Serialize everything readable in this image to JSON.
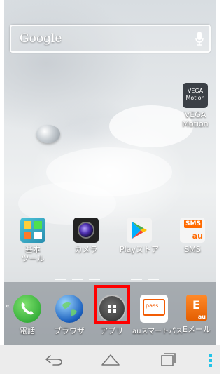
{
  "search": {
    "label": "Google"
  },
  "home_apps": [
    {
      "label": "VEGA\nMotion",
      "icon": "vega-motion-icon",
      "icon_text": "VEGA\nMotion"
    },
    {
      "label": "基本\nツール",
      "icon": "tools-folder-icon"
    },
    {
      "label": "カメラ",
      "icon": "camera-icon"
    },
    {
      "label": "Playストア",
      "icon": "play-store-icon"
    },
    {
      "label": "SMS",
      "icon": "sms-icon",
      "icon_text": "SMS"
    }
  ],
  "dock": [
    {
      "label": "電話",
      "icon": "phone-icon"
    },
    {
      "label": "ブラウザ",
      "icon": "browser-icon"
    },
    {
      "label": "アプリ",
      "icon": "apps-drawer-icon"
    },
    {
      "label": "auスマートパス",
      "icon": "au-smart-pass-icon",
      "icon_text": "pass"
    },
    {
      "label": "Eメール",
      "icon": "email-icon",
      "icon_text": "E"
    }
  ],
  "navbar": {
    "buttons": [
      "back-icon",
      "home-icon",
      "recent-apps-icon",
      "menu-icon"
    ]
  },
  "colors": {
    "highlight": "#ff0000",
    "menu_accent": "#22c4e8"
  }
}
